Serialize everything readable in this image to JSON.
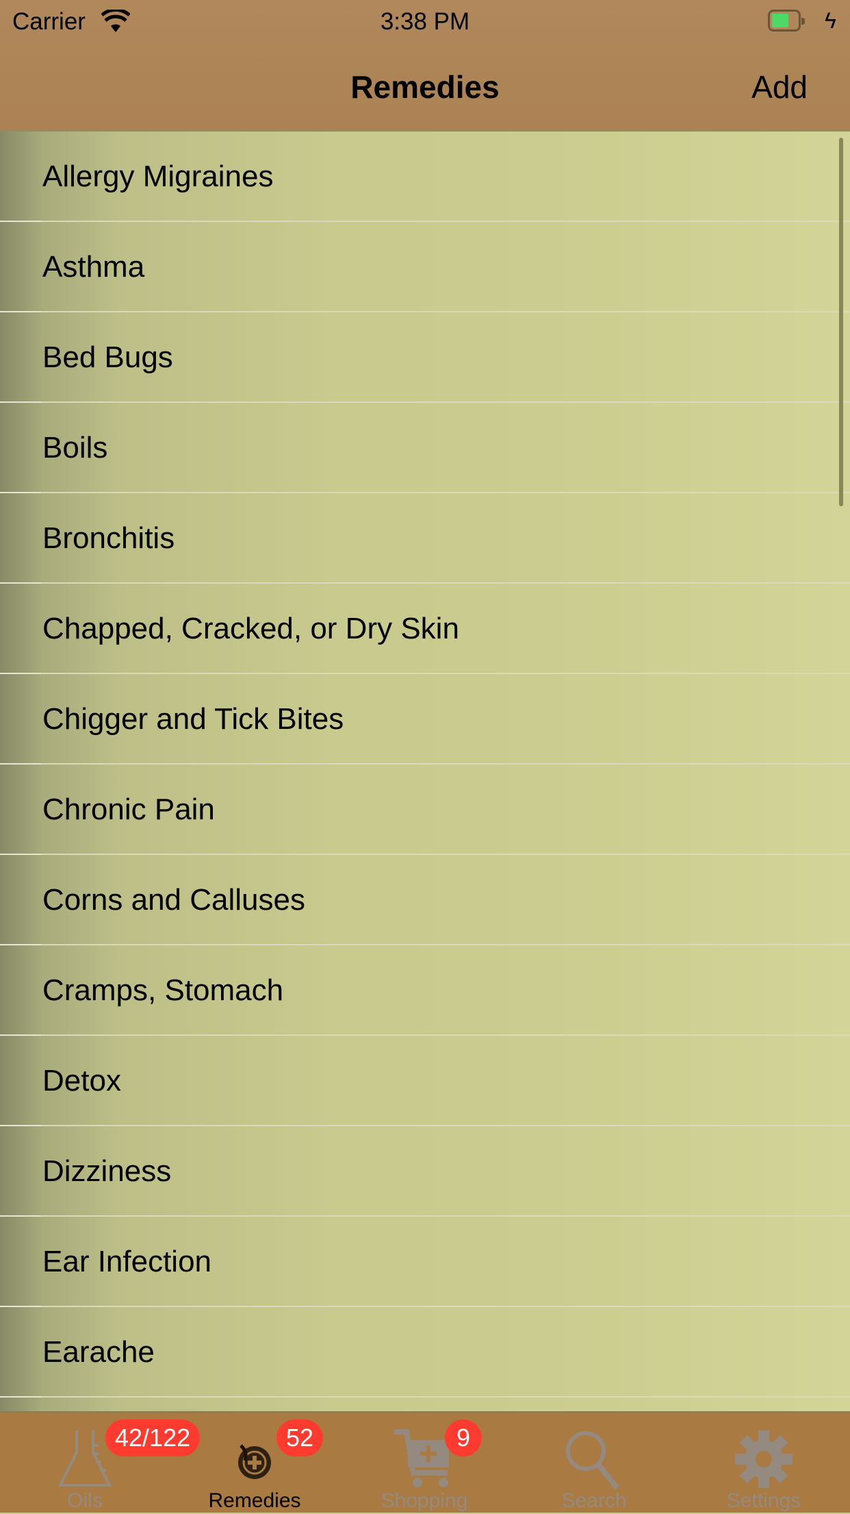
{
  "status_bar": {
    "carrier": "Carrier",
    "time": "3:38 PM"
  },
  "nav": {
    "title": "Remedies",
    "add_label": "Add"
  },
  "remedies": [
    "Allergy Migraines",
    "Asthma",
    "Bed Bugs",
    "Boils",
    "Bronchitis",
    "Chapped, Cracked, or Dry Skin",
    "Chigger and Tick Bites",
    "Chronic Pain",
    "Corns and Calluses",
    "Cramps, Stomach",
    "Detox",
    "Dizziness",
    "Ear Infection",
    "Earache",
    ""
  ],
  "tabs": [
    {
      "label": "Oils",
      "badge": "42/122",
      "icon": "flask-icon"
    },
    {
      "label": "Remedies",
      "badge": "52",
      "icon": "remedy-icon"
    },
    {
      "label": "Shopping",
      "badge": "9",
      "icon": "cart-icon"
    },
    {
      "label": "Search",
      "icon": "search-icon"
    },
    {
      "label": "Settings",
      "icon": "gear-icon"
    }
  ],
  "colors": {
    "nav": "#b0885c",
    "tabbar": "#a97a42",
    "badge": "#ff3b30",
    "battery": "#4cd964"
  }
}
